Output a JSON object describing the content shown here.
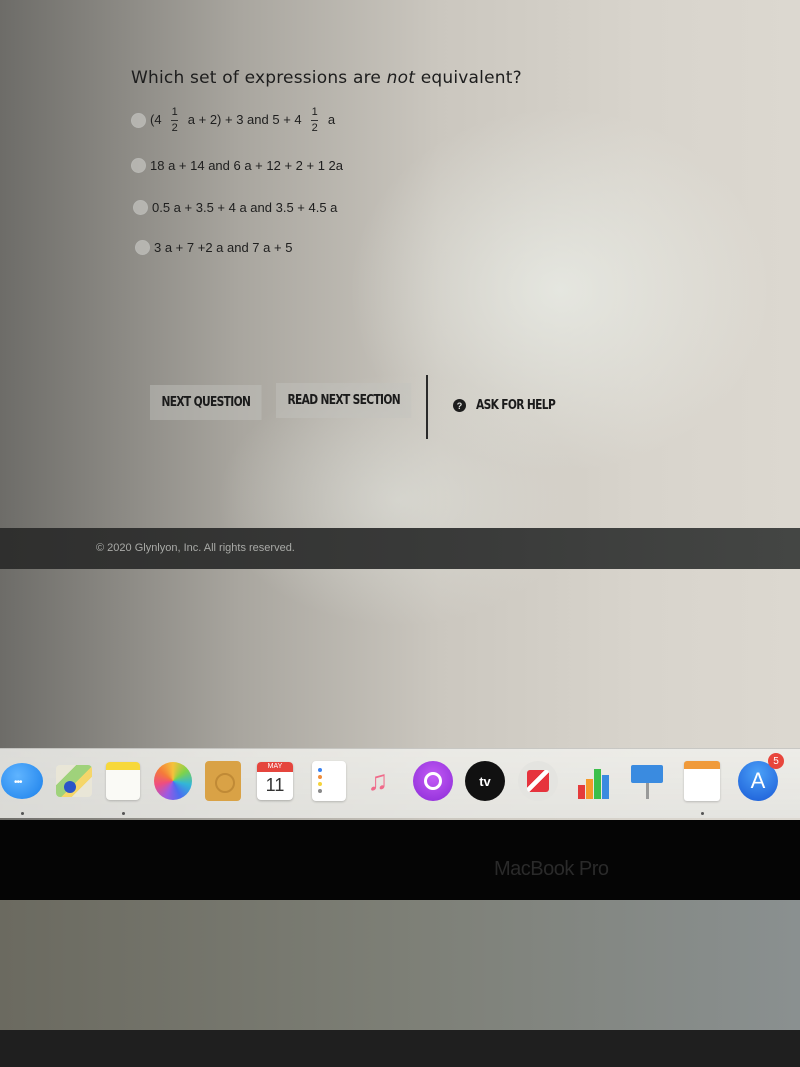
{
  "question": {
    "title_before": "Which set of expressions are ",
    "title_emphasis": "not",
    "title_after": " equivalent?"
  },
  "options": [
    {
      "id": "A",
      "text_parts": [
        "(4 ",
        "1/2",
        " a + 2) + 3 and 5 + 4 ",
        "1/2",
        " a"
      ],
      "selected": false
    },
    {
      "id": "B",
      "text": "18 a + 14 and 6 a + 12 + 2 + 1 2a",
      "selected": false
    },
    {
      "id": "C",
      "text": "0.5 a + 3.5 + 4 a and 3.5 + 4.5 a",
      "selected": false
    },
    {
      "id": "D",
      "text": "3 a + 7 +2 a and 7 a + 5",
      "selected": false
    }
  ],
  "fraction": {
    "numerator": "1",
    "denominator": "2"
  },
  "actions": {
    "next_question": "NEXT QUESTION",
    "read_next_section": "READ NEXT SECTION",
    "ask_for_help": "ASK FOR HELP",
    "help_icon_glyph": "?"
  },
  "footer": {
    "copyright": "© 2020 Glynlyon, Inc. All rights reserved."
  },
  "dock": {
    "apps": [
      {
        "name": "Messages",
        "icon": "messages-icon",
        "running": true
      },
      {
        "name": "Maps",
        "icon": "maps-icon",
        "running": false
      },
      {
        "name": "Notes",
        "icon": "notes-icon",
        "running": true
      },
      {
        "name": "Photos",
        "icon": "photos-icon",
        "running": false
      },
      {
        "name": "Contacts",
        "icon": "contacts-icon",
        "running": false
      },
      {
        "name": "Calendar",
        "icon": "calendar-icon",
        "running": false,
        "month": "MAY",
        "day": "11"
      },
      {
        "name": "Reminders",
        "icon": "reminders-icon",
        "running": false
      },
      {
        "name": "Music",
        "icon": "music-icon",
        "running": false,
        "glyph": "♫"
      },
      {
        "name": "Podcasts",
        "icon": "podcasts-icon",
        "running": false
      },
      {
        "name": "TV",
        "icon": "tv-icon",
        "running": false,
        "label": "tv"
      },
      {
        "name": "News",
        "icon": "news-icon",
        "running": false
      },
      {
        "name": "Numbers",
        "icon": "numbers-icon",
        "running": false
      },
      {
        "name": "Keynote",
        "icon": "keynote-icon",
        "running": false
      },
      {
        "name": "Pages",
        "icon": "pages-icon",
        "running": true
      },
      {
        "name": "App Store",
        "icon": "app-store-icon",
        "running": false,
        "badge": "5",
        "glyph": "A"
      }
    ]
  },
  "device": {
    "brand_label": "MacBook Pro"
  },
  "colors": {
    "footer_bg": "#333433",
    "footer_text": "#a9aaa7",
    "badge_red": "#e8463c",
    "text_dark": "#1d1d1d"
  }
}
